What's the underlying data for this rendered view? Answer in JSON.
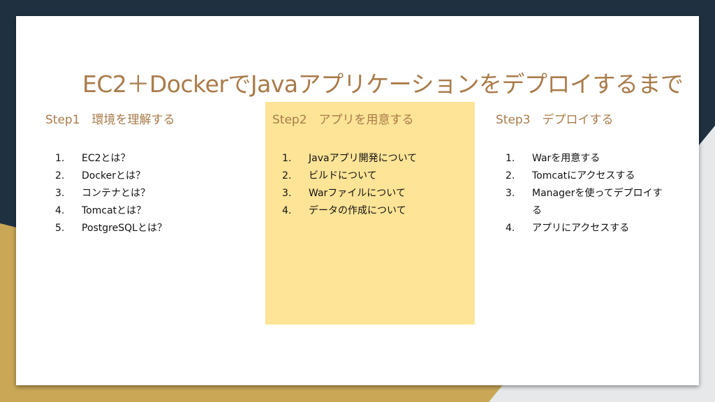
{
  "slide": {
    "title": "EC2＋DockerでJavaアプリケーションをデプロイするまで",
    "columns": [
      {
        "heading": "Step1　環境を理解する",
        "items": [
          {
            "num": "1.",
            "text": "EC2とは？"
          },
          {
            "num": "2.",
            "text": "Dockerとは？"
          },
          {
            "num": "3.",
            "text": "コンテナとは？"
          },
          {
            "num": "4.",
            "text": "Tomcatとは？"
          },
          {
            "num": "5.",
            "text": "PostgreSQLとは？"
          }
        ]
      },
      {
        "heading": "Step2　アプリを用意する",
        "items": [
          {
            "num": "1.",
            "text": "Javaアプリ開発について"
          },
          {
            "num": "2.",
            "text": "ビルドについて"
          },
          {
            "num": "3.",
            "text": "Warファイルについて"
          },
          {
            "num": "4.",
            "text": "データの作成について"
          }
        ]
      },
      {
        "heading": "Step3　デプロイする",
        "items": [
          {
            "num": "1.",
            "text": "Warを用意する"
          },
          {
            "num": "2.",
            "text": "Tomcatにアクセスする"
          },
          {
            "num": "3.",
            "text": "Managerを使ってデプロイする"
          },
          {
            "num": "4.",
            "text": "アプリにアクセスする"
          }
        ]
      }
    ]
  },
  "colors": {
    "title": "#a97b4a",
    "highlight": "#fde496",
    "background_dark": "#1f3140",
    "background_gold": "#c9a757"
  }
}
